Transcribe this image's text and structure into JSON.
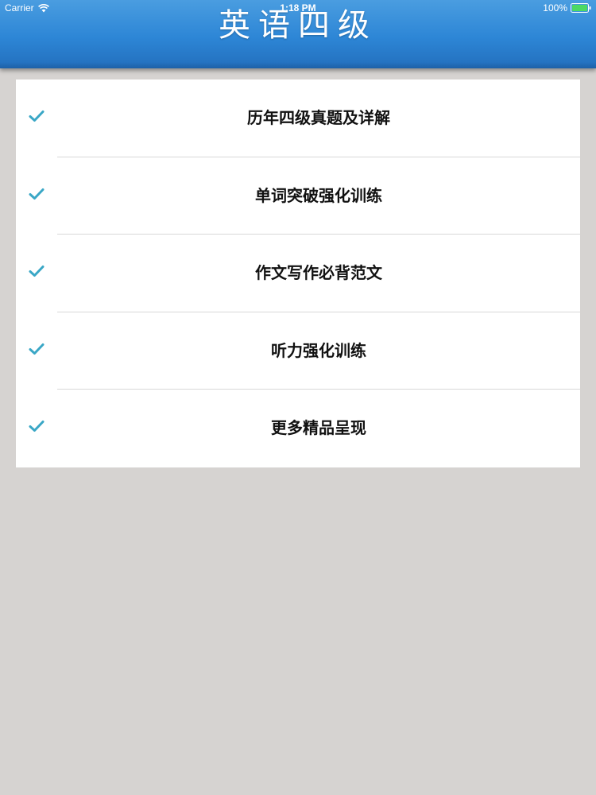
{
  "status_bar": {
    "carrier": "Carrier",
    "time": "1:18 PM",
    "battery": "100%",
    "icons": [
      "wifi-icon",
      "battery-icon"
    ]
  },
  "header": {
    "title": "英语四级"
  },
  "menu": {
    "items": [
      {
        "label": "历年四级真题及详解",
        "icon": "check-icon"
      },
      {
        "label": "单词突破强化训练",
        "icon": "check-icon"
      },
      {
        "label": "作文写作必背范文",
        "icon": "check-icon"
      },
      {
        "label": "听力强化训练",
        "icon": "check-icon"
      },
      {
        "label": "更多精品呈现",
        "icon": "check-icon"
      }
    ]
  },
  "colors": {
    "header_blue": "#2d86d6",
    "check_teal": "#3aa7c6",
    "background": "#d6d3d1",
    "battery_green": "#4cd964"
  }
}
